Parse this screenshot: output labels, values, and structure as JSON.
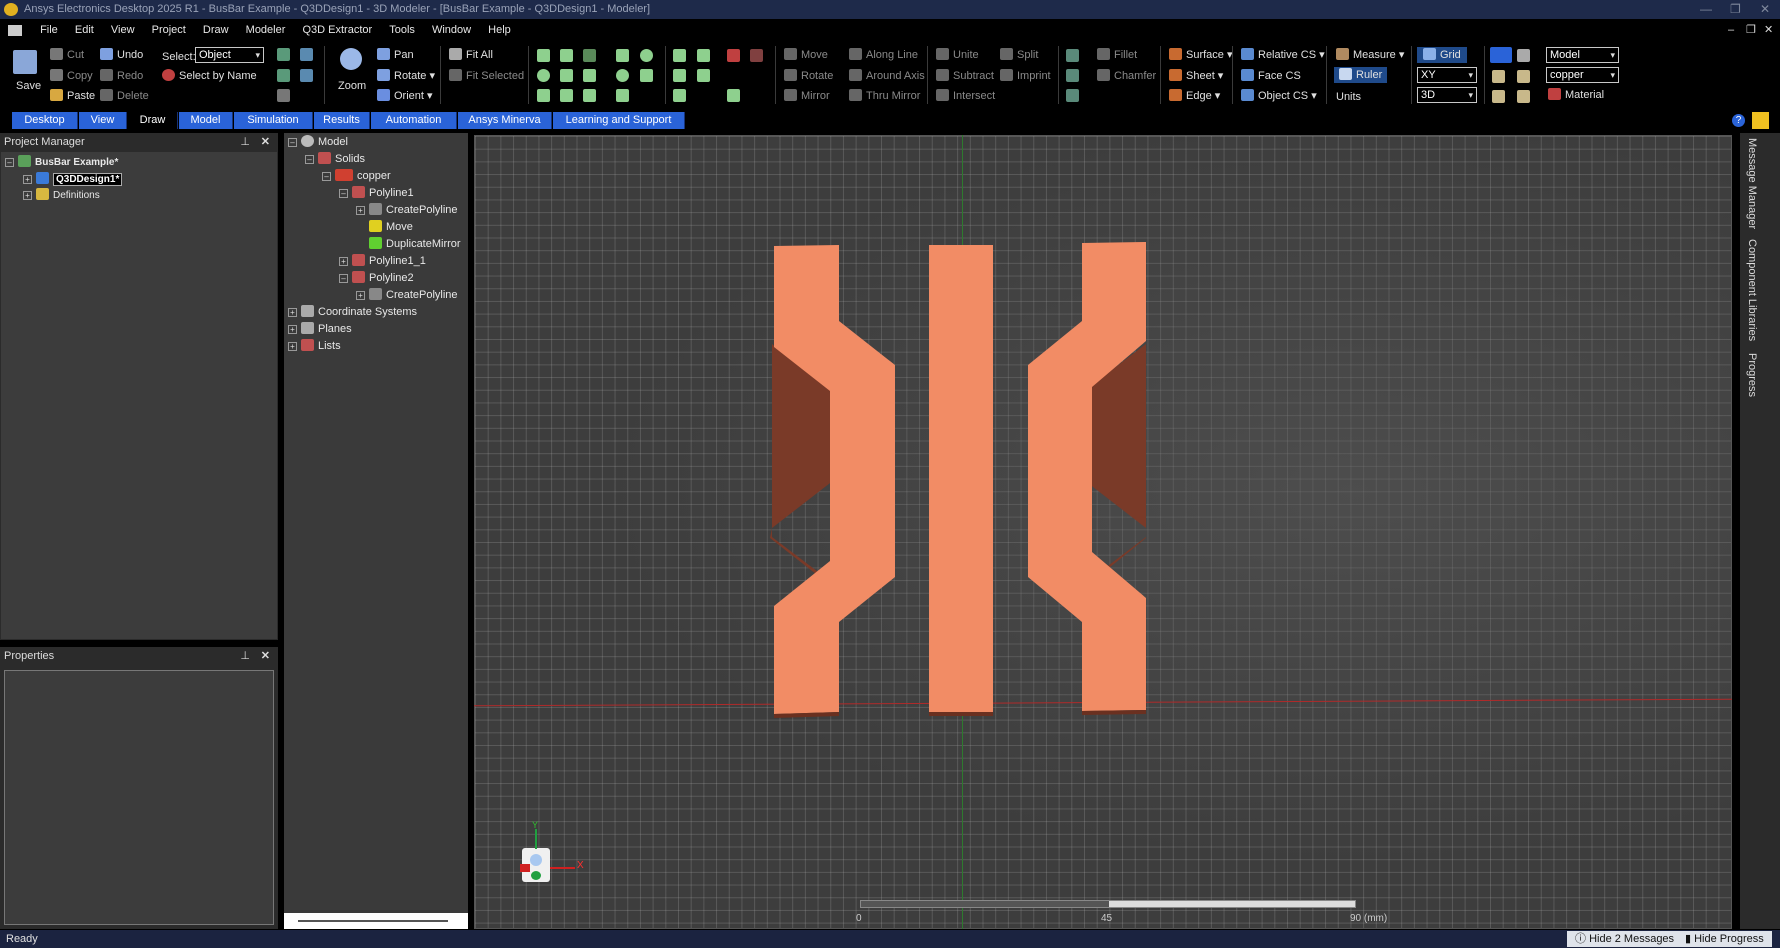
{
  "window": {
    "title": "Ansys Electronics Desktop 2025 R1 - BusBar Example - Q3DDesign1 - 3D Modeler - [BusBar Example - Q3DDesign1 - Modeler]"
  },
  "menu": [
    "File",
    "Edit",
    "View",
    "Project",
    "Draw",
    "Modeler",
    "Q3D Extractor",
    "Tools",
    "Window",
    "Help"
  ],
  "ribbon": {
    "save": "Save",
    "cut": "Cut",
    "copy": "Copy",
    "paste": "Paste",
    "undo": "Undo",
    "redo": "Redo",
    "delete": "Delete",
    "select_label": "Select:",
    "select_value": "Object",
    "select_by_name": "Select by Name",
    "zoom": "Zoom",
    "pan": "Pan",
    "rotate": "Rotate",
    "orient": "Orient",
    "fit_all": "Fit All",
    "fit_selected": "Fit Selected",
    "move": "Move",
    "rotate2": "Rotate",
    "mirror": "Mirror",
    "along_line": "Along Line",
    "around_axis": "Around Axis",
    "thru_mirror": "Thru Mirror",
    "unite": "Unite",
    "subtract": "Subtract",
    "intersect": "Intersect",
    "split": "Split",
    "imprint": "Imprint",
    "fillet": "Fillet",
    "chamfer": "Chamfer",
    "surface": "Surface",
    "sheet": "Sheet",
    "edge": "Edge",
    "relative_cs": "Relative CS",
    "face_cs": "Face CS",
    "object_cs": "Object CS",
    "measure": "Measure",
    "ruler": "Ruler",
    "units": "Units",
    "grid": "Grid",
    "plane_value": "XY",
    "dim_value": "3D",
    "model_value": "Model",
    "material_value": "copper",
    "material": "Material"
  },
  "tabs": [
    "Desktop",
    "View",
    "Draw",
    "Model",
    "Simulation",
    "Results",
    "Automation",
    "Ansys Minerva",
    "Learning and Support"
  ],
  "active_tab": "Draw",
  "project_manager": {
    "title": "Project Manager",
    "project": "BusBar Example*",
    "design": "Q3DDesign1*",
    "definitions": "Definitions"
  },
  "properties": {
    "title": "Properties"
  },
  "model_tree": {
    "root": "Model",
    "solids": "Solids",
    "material": "copper",
    "polyline1": "Polyline1",
    "create_polyline": "CreatePolyline",
    "move": "Move",
    "duplicate_mirror": "DuplicateMirror",
    "polyline1_1": "Polyline1_1",
    "polyline2": "Polyline2",
    "create_polyline2": "CreatePolyline",
    "coordinate_systems": "Coordinate Systems",
    "planes": "Planes",
    "lists": "Lists"
  },
  "viewport": {
    "shape_color": "#f28c65",
    "triad_x": "X",
    "triad_y": "Y",
    "scale_0": "0",
    "scale_45": "45",
    "scale_90": "90 (mm)"
  },
  "side_tabs": [
    "Message Manager",
    "Component Libraries",
    "Progress"
  ],
  "status": {
    "text": "Ready",
    "hide_messages": "Hide 2 Messages",
    "hide_progress": "Hide Progress"
  }
}
